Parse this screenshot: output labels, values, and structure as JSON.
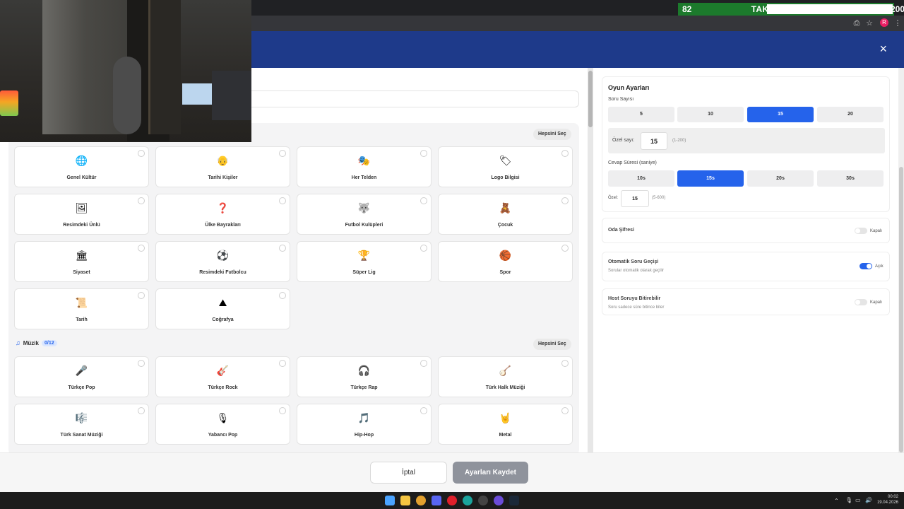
{
  "overlay": {
    "current": "82",
    "label": "TAKİPÇİ HEDEFİ",
    "target": "200",
    "progress": 0.41
  },
  "modal": {
    "close_glyph": "×"
  },
  "categories_section": {
    "select_all": "Hepsini Seç",
    "items": [
      {
        "label": "Genel Kültür",
        "icon": "globe-icon",
        "glyph": "🌐"
      },
      {
        "label": "Tarihi Kişiler",
        "icon": "historical-figure-icon",
        "glyph": "👴"
      },
      {
        "label": "Her Telden",
        "icon": "mixed-topics-icon",
        "glyph": "🎭"
      },
      {
        "label": "Logo Bilgisi",
        "icon": "logo-icon",
        "glyph": "🏷"
      },
      {
        "label": "Resimdeki Ünlü",
        "icon": "celebrity-photo-icon",
        "glyph": "🖼"
      },
      {
        "label": "Ülke Bayrakları",
        "icon": "flag-question-icon",
        "glyph": "❓"
      },
      {
        "label": "Futbol Kulüpleri",
        "icon": "football-club-icon",
        "glyph": "🐺"
      },
      {
        "label": "Çocuk",
        "icon": "child-icon",
        "glyph": "🧸"
      },
      {
        "label": "Siyaset",
        "icon": "politics-icon",
        "glyph": "🏛"
      },
      {
        "label": "Resimdeki Futbolcu",
        "icon": "footballer-icon",
        "glyph": "⚽"
      },
      {
        "label": "Süper Lig",
        "icon": "super-league-icon",
        "glyph": "🏆"
      },
      {
        "label": "Spor",
        "icon": "sports-icon",
        "glyph": "🏀"
      },
      {
        "label": "Tarih",
        "icon": "history-icon",
        "glyph": "📜"
      },
      {
        "label": "Coğrafya",
        "icon": "geography-icon",
        "glyph": "⛰"
      }
    ]
  },
  "music_section": {
    "title": "Müzik",
    "count": "0/12",
    "select_all": "Hepsini Seç",
    "items": [
      {
        "label": "Türkçe Pop",
        "icon": "turkish-pop-icon",
        "glyph": "🎤"
      },
      {
        "label": "Türkçe Rock",
        "icon": "turkish-rock-icon",
        "glyph": "🎸"
      },
      {
        "label": "Türkçe Rap",
        "icon": "turkish-rap-icon",
        "glyph": "🎧"
      },
      {
        "label": "Türk Halk Müziği",
        "icon": "folk-music-icon",
        "glyph": "🪕"
      },
      {
        "label": "Türk Sanat Müziği",
        "icon": "classical-music-icon",
        "glyph": "🎼"
      },
      {
        "label": "Yabancı Pop",
        "icon": "foreign-pop-icon",
        "glyph": "🎙"
      },
      {
        "label": "Hip-Hop",
        "icon": "hiphop-icon",
        "glyph": "🎵"
      },
      {
        "label": "Metal",
        "icon": "metal-icon",
        "glyph": "🤘"
      }
    ]
  },
  "settings": {
    "title": "Oyun Ayarları",
    "question_count": {
      "label": "Soru Sayısı",
      "options": [
        "5",
        "10",
        "15",
        "20"
      ],
      "selected": "15",
      "custom_label": "Özel sayı:",
      "custom_value": "15",
      "custom_hint": "(1-200)"
    },
    "answer_time": {
      "label": "Cevap Süresi (saniye)",
      "options": [
        "10s",
        "15s",
        "20s",
        "30s"
      ],
      "selected": "15s",
      "custom_label": "Özel:",
      "custom_value": "15",
      "custom_hint": "(5-600)"
    },
    "room_password": {
      "label": "Oda Şifresi",
      "state": "Kapalı",
      "on": false
    },
    "auto_next": {
      "label": "Otomatik Soru Geçişi",
      "desc": "Sorular otomatik olarak geçilir",
      "state": "Açık",
      "on": true
    },
    "host_finish": {
      "label": "Host Soruyu Bitirebilir",
      "desc": "Soru sadece süre bitince biter",
      "state": "Kapalı",
      "on": false
    }
  },
  "footer": {
    "cancel": "İptal",
    "save": "Ayarları Kaydet"
  },
  "taskbar": {
    "time": "00:02",
    "date": "19.04.2026"
  }
}
